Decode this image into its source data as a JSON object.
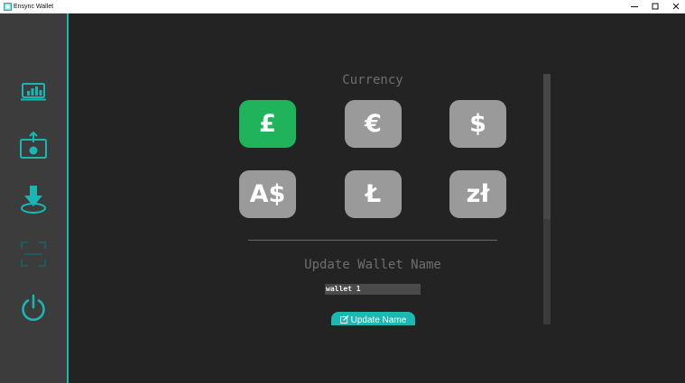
{
  "window": {
    "title": "Ensync Wallet"
  },
  "colors": {
    "accent": "#17b8b3",
    "selected_currency": "#1fb35c",
    "currency_button": "#9a9a9a",
    "sidebar_bg": "#3c3c3c",
    "main_bg": "#232323"
  },
  "sidebar": {
    "items": [
      {
        "icon": "dashboard-chart-icon",
        "enabled": true
      },
      {
        "icon": "send-upload-icon",
        "enabled": true
      },
      {
        "icon": "receive-download-icon",
        "enabled": true
      },
      {
        "icon": "scan-qr-icon",
        "enabled": false
      },
      {
        "icon": "power-icon",
        "enabled": true
      }
    ]
  },
  "currency": {
    "title": "Currency",
    "options": [
      {
        "symbol": "£",
        "selected": true
      },
      {
        "symbol": "€",
        "selected": false
      },
      {
        "symbol": "$",
        "selected": false
      },
      {
        "symbol": "A$",
        "selected": false
      },
      {
        "symbol": "Ł",
        "selected": false
      },
      {
        "symbol": "zł",
        "selected": false
      }
    ]
  },
  "wallet_name": {
    "title": "Update Wallet Name",
    "value": "wallet 1",
    "button_label": "Update Name"
  }
}
